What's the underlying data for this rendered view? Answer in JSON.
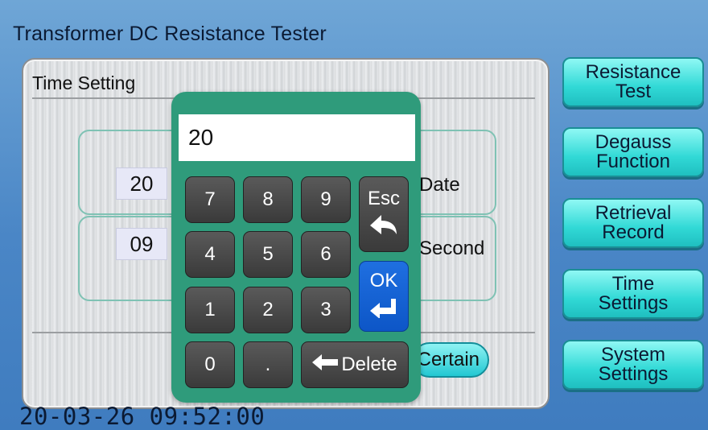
{
  "app_title": "Transformer DC Resistance Tester",
  "panel": {
    "title": "Time Setting",
    "row1": {
      "value": "20",
      "label": "Date"
    },
    "row2": {
      "value": "09",
      "label": "Second"
    },
    "certain_label": "Certain"
  },
  "nav": [
    {
      "line1": "Resistance",
      "line2": "Test"
    },
    {
      "line1": "Degauss",
      "line2": "Function"
    },
    {
      "line1": "Retrieval",
      "line2": "Record"
    },
    {
      "line1": "Time",
      "line2": "Settings"
    },
    {
      "line1": "System",
      "line2": "Settings"
    }
  ],
  "status": {
    "datetime": "20-03-26 09:52:00"
  },
  "keypad": {
    "display": "20",
    "keys": {
      "k7": "7",
      "k8": "8",
      "k9": "9",
      "k4": "4",
      "k5": "5",
      "k6": "6",
      "k1": "1",
      "k2": "2",
      "k3": "3",
      "k0": "0",
      "dot": "."
    },
    "esc_label": "Esc",
    "ok_label": "OK",
    "delete_label": "Delete"
  },
  "colors": {
    "background": "#4a86c6",
    "keypad_bg": "#2f9b7b",
    "nav_button": "#31d9d6",
    "ok_key": "#1f6fe0",
    "key": "#4a4a4a"
  }
}
